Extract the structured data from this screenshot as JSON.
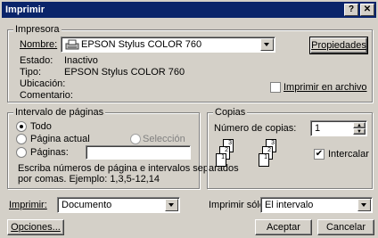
{
  "window": {
    "title": "Imprimir",
    "help_label": "?",
    "close_label": "✕"
  },
  "printer": {
    "legend": "Impresora",
    "name_label": "Nombre:",
    "name_value": "EPSON Stylus COLOR 760",
    "properties_label": "Propiedades",
    "status_label": "Estado:",
    "status_value": "Inactivo",
    "type_label": "Tipo:",
    "type_value": "EPSON Stylus COLOR 760",
    "location_label": "Ubicación:",
    "comment_label": "Comentario:",
    "print_to_file_label": "Imprimir en archivo",
    "print_to_file_checked": false
  },
  "range": {
    "legend": "Intervalo de páginas",
    "all_label": "Todo",
    "current_label": "Página actual",
    "selection_label": "Selección",
    "pages_label": "Páginas:",
    "pages_value": "",
    "hint_line1": "Escriba números de página e intervalos separados",
    "hint_line2": "por comas. Ejemplo: 1,3,5-12,14",
    "selected": "all"
  },
  "copies": {
    "legend": "Copias",
    "count_label": "Número de copias:",
    "count_value": "1",
    "collate_label": "Intercalar",
    "collate_checked": true,
    "page_numbers": [
      "1",
      "2",
      "3",
      "1",
      "2",
      "3"
    ]
  },
  "bottom": {
    "print_label": "Imprimir:",
    "print_value": "Documento",
    "print_only_label": "Imprimir sólo:",
    "print_only_value": "El intervalo",
    "options_label": "Opciones...",
    "accept_label": "Aceptar",
    "cancel_label": "Cancelar"
  },
  "colors": {
    "titlebar": "#0a246a",
    "face": "#d4d0c8"
  },
  "icons": {
    "printer": "printer-icon",
    "collate": "collate-pages-icon"
  }
}
